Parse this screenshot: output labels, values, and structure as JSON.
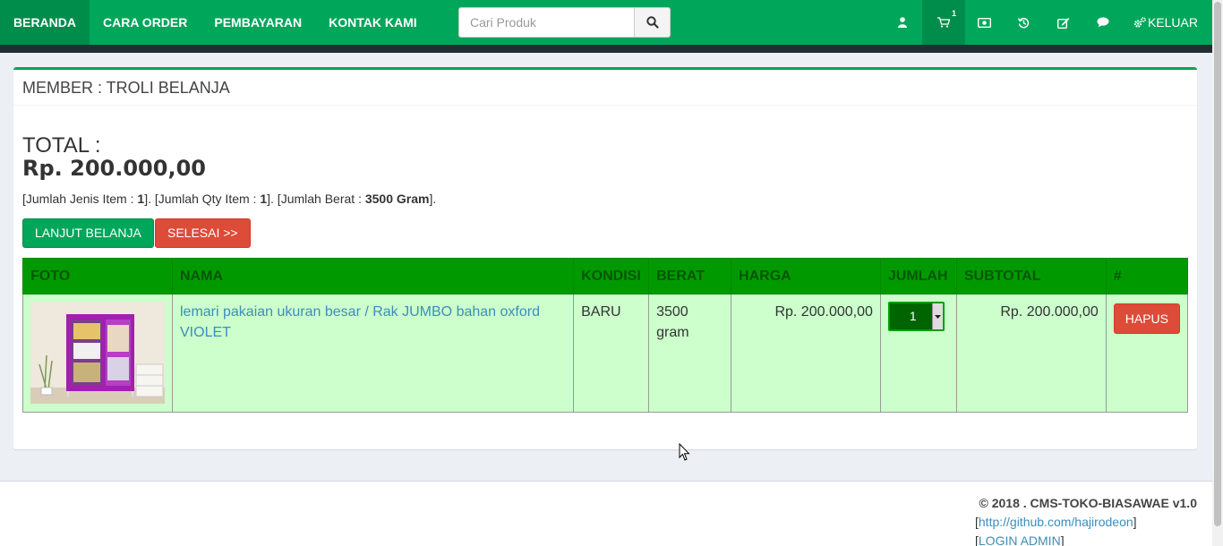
{
  "nav": {
    "items": [
      {
        "label": "BERANDA",
        "active": true
      },
      {
        "label": "CARA ORDER"
      },
      {
        "label": "PEMBAYARAN"
      },
      {
        "label": "KONTAK KAMI"
      }
    ],
    "search_placeholder": "Cari Produk",
    "search_icon": "search-icon",
    "icons": [
      "user-icon",
      "cart-icon",
      "money-icon",
      "history-icon",
      "edit-icon",
      "chat-icon"
    ],
    "cart_count": "1",
    "logout_label": "KELUAR",
    "logout_icon": "gears-icon",
    "accent": "#00a65a",
    "accent_dark": "#008d4c"
  },
  "panel": {
    "title": "MEMBER : TROLI BELANJA",
    "total_label": "TOTAL :",
    "total_value": "Rp. 200.000,00",
    "summary": {
      "p1": "[Jumlah Jenis Item : ",
      "v1": "1",
      "p2": "]. [Jumlah Qty Item : ",
      "v2": "1",
      "p3": "]. [Jumlah Berat : ",
      "v3": "3500 Gram",
      "p4": "]."
    },
    "continue_label": "LANJUT BELANJA",
    "finish_label": "SELESAI >>"
  },
  "table": {
    "headers": [
      "FOTO",
      "NAMA",
      "KONDISI",
      "BERAT",
      "HARGA",
      "JUMLAH",
      "SUBTOTAL",
      "#"
    ],
    "rows": [
      {
        "name": "lemari pakaian ukuran besar / Rak JUMBO bahan oxford VIOLET",
        "condition": "BARU",
        "weight": "3500 gram",
        "price": "Rp. 200.000,00",
        "qty": "1",
        "subtotal": "Rp. 200.000,00",
        "delete_label": "HAPUS"
      }
    ]
  },
  "footer": {
    "copyright": "© 2018 . CMS-TOKO-BIASAWAE v1.0",
    "github": "http://github.com/hajirodeon",
    "login": "LOGIN ADMIN"
  }
}
